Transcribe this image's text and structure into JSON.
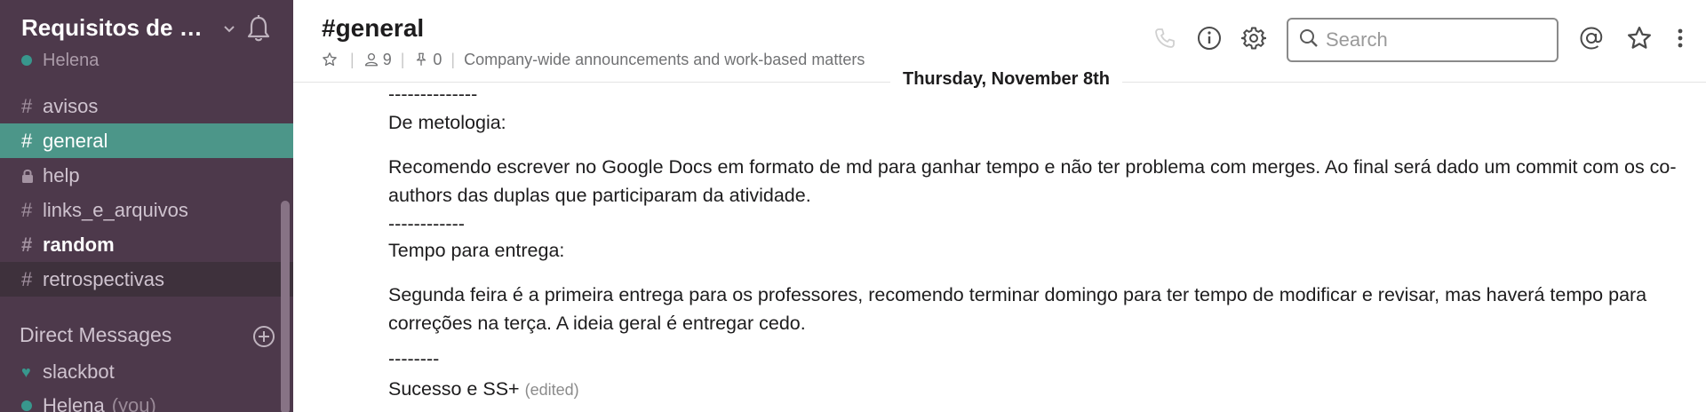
{
  "sidebar": {
    "team_name": "Requisitos de S...",
    "user_name": "Helena",
    "channels": [
      {
        "label": "avisos"
      },
      {
        "label": "general"
      },
      {
        "label": "help"
      },
      {
        "label": "links_e_arquivos"
      },
      {
        "label": "random"
      },
      {
        "label": "retrospectivas"
      }
    ],
    "channel_prefix": "#",
    "direct_messages_label": "Direct Messages",
    "dms": [
      {
        "label": "slackbot"
      },
      {
        "label": "Helena",
        "suffix": "(you)"
      }
    ]
  },
  "header": {
    "title": "#general",
    "members_count": "9",
    "pins_count": "0",
    "topic": "Company-wide announcements and work-based matters",
    "meta_separator": "|",
    "search_placeholder": "Search"
  },
  "messages": {
    "day_divider": "Thursday, November 8th",
    "lines": [
      "--------------",
      "De metologia:",
      "Recomendo escrever no Google Docs em formato de md para ganhar tempo e não ter problema com merges. Ao final será dado um commit com os co-authors das duplas que participaram da atividade.",
      "------------",
      "Tempo para entrega:",
      "Segunda feira é a primeira entrega para os professores, recomendo terminar domingo para ter tempo de modificar e revisar, mas haverá tempo para correções na terça. A ideia geral é entregar cedo.",
      "--------",
      "Sucesso e SS+"
    ],
    "edited_label": "(edited)"
  },
  "colors": {
    "sidebar_bg": "#4d394b",
    "active_channel_bg": "#4c9689",
    "presence_green": "#38978d"
  }
}
